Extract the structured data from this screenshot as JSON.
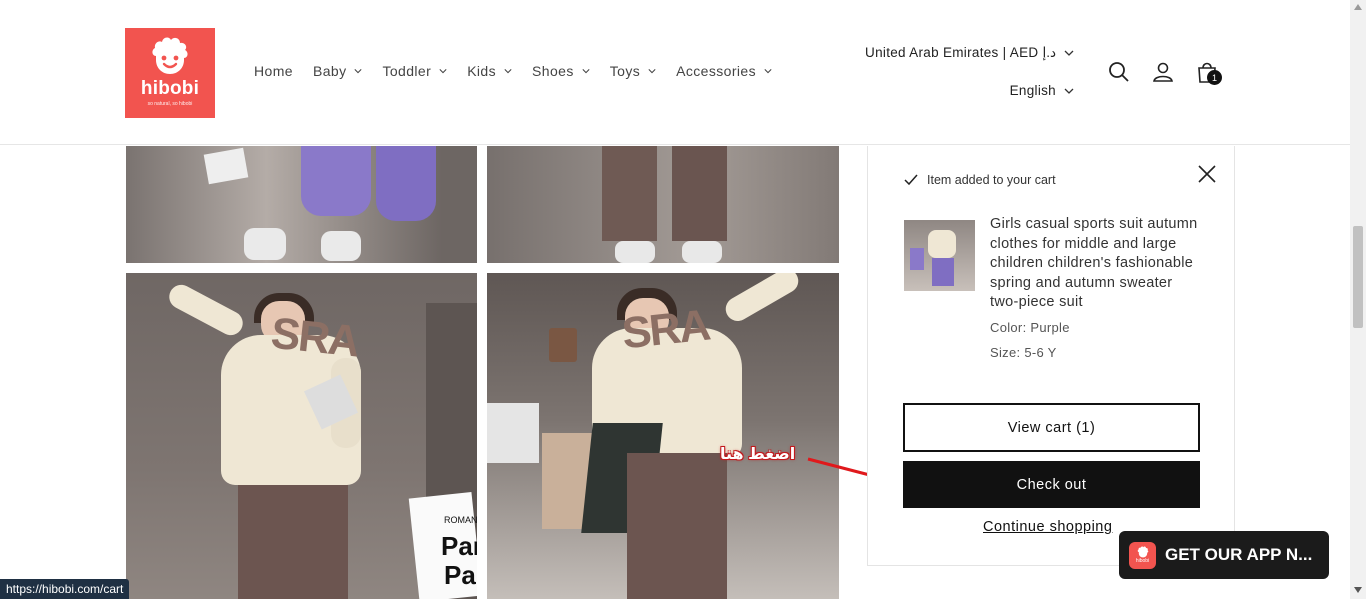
{
  "brand": {
    "name": "hibobi",
    "tagline": "so natural, so hibobi",
    "color": "#f2544f"
  },
  "nav": [
    {
      "label": "Home",
      "has_dropdown": false
    },
    {
      "label": "Baby",
      "has_dropdown": true
    },
    {
      "label": "Toddler",
      "has_dropdown": true
    },
    {
      "label": "Kids",
      "has_dropdown": true
    },
    {
      "label": "Shoes",
      "has_dropdown": true
    },
    {
      "label": "Toys",
      "has_dropdown": true
    },
    {
      "label": "Accessories",
      "has_dropdown": true
    }
  ],
  "locale": {
    "country": "United Arab Emirates | AED د.إ",
    "language": "English"
  },
  "header_icons": [
    "search-icon",
    "account-icon",
    "cart-icon"
  ],
  "cart_count": "1",
  "cart_drawer": {
    "status": "Item added to your cart",
    "product": {
      "title": "Girls casual sports suit autumn clothes for middle and large children children's fashionable spring and autumn sweater two-piece suit",
      "color": "Color: Purple",
      "size": "Size: 5-6 Y"
    },
    "view_cart_label": "View cart (1)",
    "checkout_label": "Check out",
    "continue_label": "Continue shopping"
  },
  "gallery": {
    "sweater_print": "SRA",
    "bag_text": [
      "ROMANT",
      "Par",
      "Pa",
      "Pa"
    ]
  },
  "annotation": "اضغط هنا",
  "app_banner": {
    "label": "GET OUR APP N...",
    "icon_text": "hibobi"
  },
  "status_url": "https://hibobi.com/cart",
  "colors": {
    "accent": "#f2544f",
    "button_dark": "#111111",
    "annotation_red": "#e0191c"
  }
}
